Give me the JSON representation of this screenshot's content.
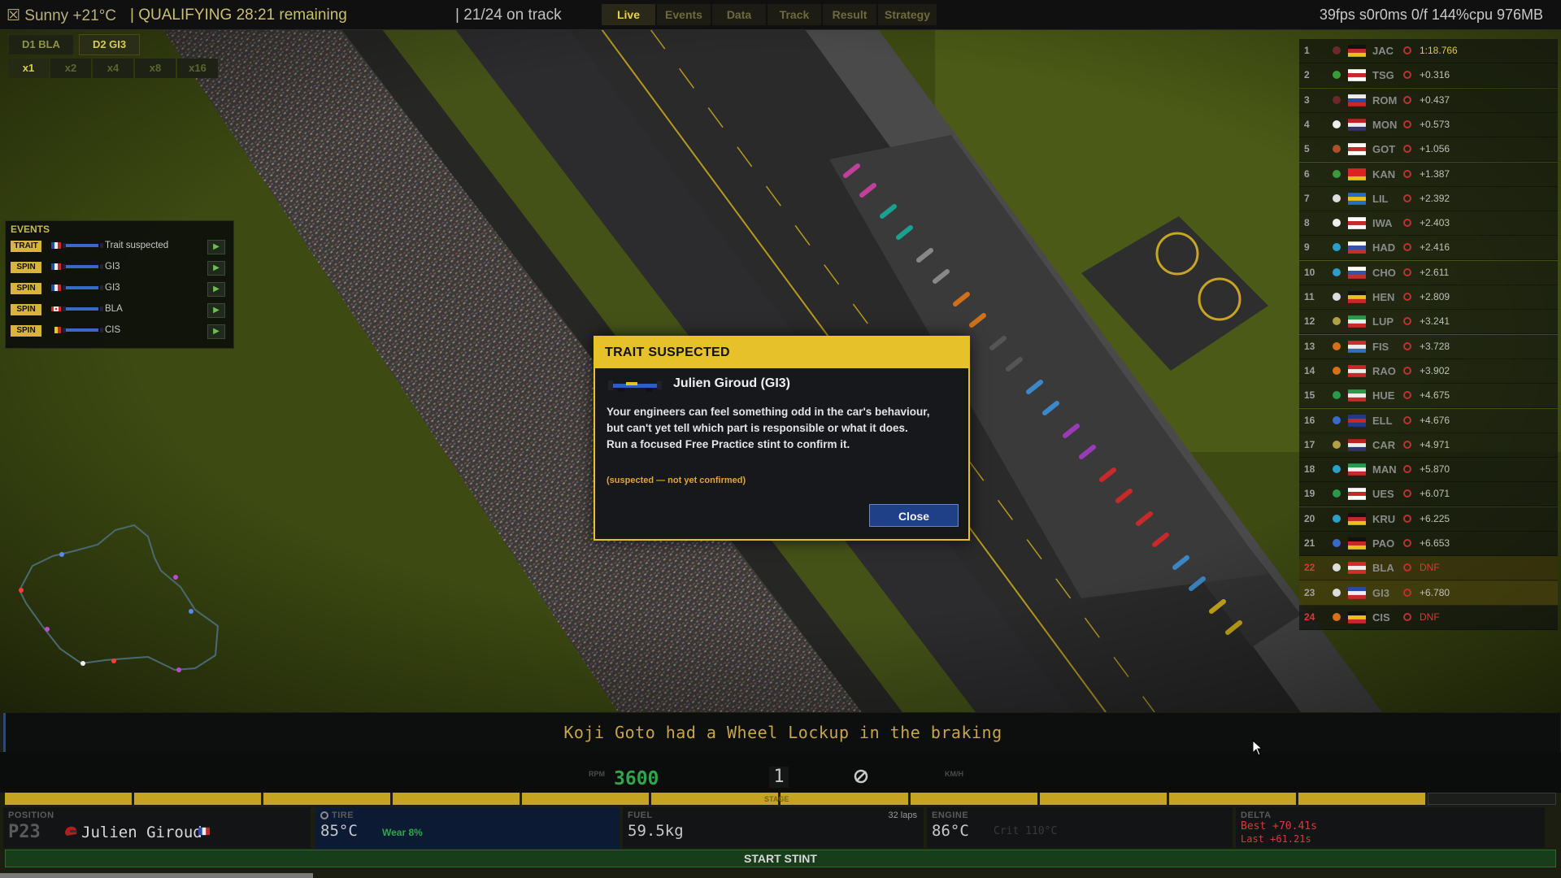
{
  "topbar": {
    "weather": "☒ Sunny +21°C",
    "session": "| QUALIFYING 28:21 remaining",
    "on_track": "| 21/24 on track",
    "perf": "39fps s0r0ms 0/f 144%cpu 976MB",
    "tabs": [
      "Live",
      "Events",
      "Data",
      "Track",
      "Result",
      "Strategy"
    ],
    "active_tab": "Live"
  },
  "camera": {
    "drivers": [
      "D1 BLA",
      "D2 GI3"
    ],
    "speeds": [
      "x1",
      "x2",
      "x4",
      "x8",
      "x16"
    ],
    "active_speed": "x1"
  },
  "events": {
    "title": "EVENTS",
    "items": [
      {
        "tag": "TRAIT",
        "text": "Trait suspected"
      },
      {
        "tag": "SPIN",
        "text": "GI3"
      },
      {
        "tag": "SPIN",
        "text": "GI3"
      },
      {
        "tag": "SPIN",
        "text": "BLA"
      },
      {
        "tag": "SPIN",
        "text": "CIS"
      }
    ]
  },
  "standings": [
    {
      "pos": "1",
      "code": "JAC",
      "gap": "1:18.766"
    },
    {
      "pos": "2",
      "code": "TSG",
      "gap": "+0.316"
    },
    {
      "pos": "3",
      "code": "ROM",
      "gap": "+0.437"
    },
    {
      "pos": "4",
      "code": "MON",
      "gap": "+0.573"
    },
    {
      "pos": "5",
      "code": "GOT",
      "gap": "+1.056"
    },
    {
      "pos": "6",
      "code": "KAN",
      "gap": "+1.387"
    },
    {
      "pos": "7",
      "code": "LIL",
      "gap": "+2.392"
    },
    {
      "pos": "8",
      "code": "IWA",
      "gap": "+2.403"
    },
    {
      "pos": "9",
      "code": "HAD",
      "gap": "+2.416"
    },
    {
      "pos": "10",
      "code": "CHO",
      "gap": "+2.611"
    },
    {
      "pos": "11",
      "code": "HEN",
      "gap": "+2.809"
    },
    {
      "pos": "12",
      "code": "LUP",
      "gap": "+3.241"
    },
    {
      "pos": "13",
      "code": "FIS",
      "gap": "+3.728"
    },
    {
      "pos": "14",
      "code": "RAO",
      "gap": "+3.902"
    },
    {
      "pos": "15",
      "code": "HUE",
      "gap": "+4.675"
    },
    {
      "pos": "16",
      "code": "ELL",
      "gap": "+4.676"
    },
    {
      "pos": "17",
      "code": "CAR",
      "gap": "+4.971"
    },
    {
      "pos": "18",
      "code": "MAN",
      "gap": "+5.870"
    },
    {
      "pos": "19",
      "code": "UES",
      "gap": "+6.071"
    },
    {
      "pos": "20",
      "code": "KRU",
      "gap": "+6.225"
    },
    {
      "pos": "21",
      "code": "PAO",
      "gap": "+6.653"
    },
    {
      "pos": "22",
      "code": "BLA",
      "gap": "DNF"
    },
    {
      "pos": "23",
      "code": "GI3",
      "gap": "+6.780"
    },
    {
      "pos": "24",
      "code": "CIS",
      "gap": "DNF"
    }
  ],
  "modal": {
    "title": "TRAIT SUSPECTED",
    "driver": "Julien Giroud (GI3)",
    "body": "Your engineers can feel something odd in the car's behaviour, but can't yet tell which part is responsible or what it does. Run a focused Free Practice stint to confirm it.",
    "note": "(suspected — not yet confirmed)",
    "close_label": "Close"
  },
  "ticker": "Koji Goto had a Wheel Lockup in the braking",
  "gauges": {
    "rpm_label": "RPM",
    "rpm": "3600",
    "gear": "1",
    "speed_label": "KM/H",
    "stage_label": "STAGE"
  },
  "progress_segments_filled": 11,
  "progress_segments_total": 12,
  "info": {
    "position_label": "POSITION",
    "position": "P23",
    "driver": "Julien Giroud",
    "tire_label": "TIRE",
    "tire_temp": "85°C",
    "tire_wear": "Wear 8%",
    "fuel_label": "FUEL",
    "fuel": "59.5kg",
    "fuel_laps": "32 laps",
    "engine_label": "ENGINE",
    "engine_temp": "86°C",
    "engine_crit": "Crit 110°C",
    "delta_label": "DELTA",
    "delta_best": "Best +70.41s",
    "delta_last": "Last +61.21s"
  },
  "start_stint_label": "START STINT",
  "colors": {
    "accent": "#e6c12a",
    "grass": "#3d4a12",
    "close_button": "#1f3f86",
    "start_stint": "#183d1a"
  }
}
